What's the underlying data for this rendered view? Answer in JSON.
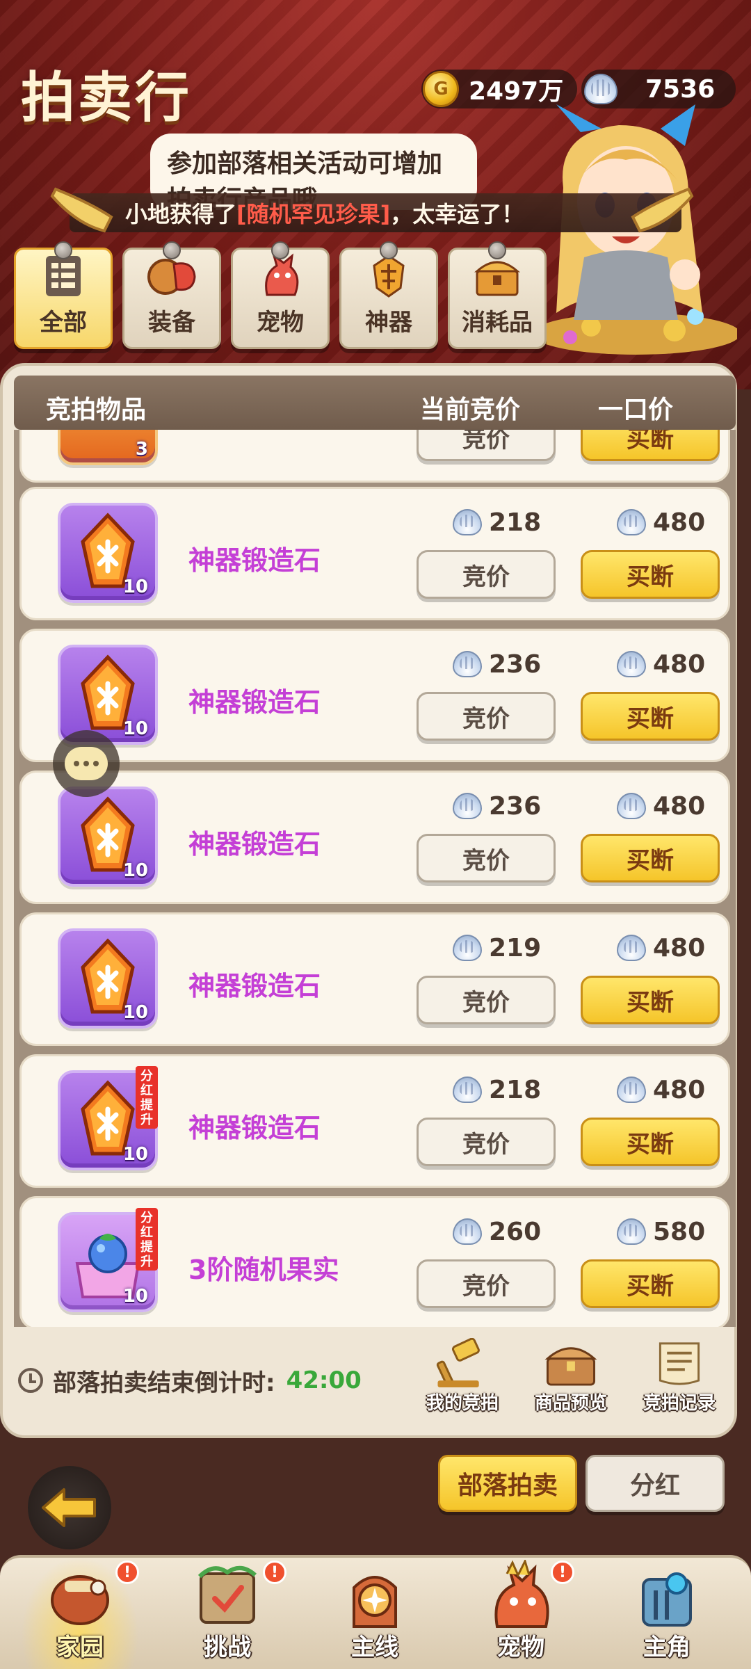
{
  "header": {
    "title": "拍卖行",
    "gold_amount": "2497万",
    "gem_amount": "7536",
    "tip_text": "参加部落相关活动可增加拍卖行产品哦",
    "announcement_prefix": "小地获得了",
    "announcement_item": "[随机罕见珍果]",
    "announcement_suffix": "，太幸运了！"
  },
  "categories": [
    {
      "label": "全部",
      "icon": "list-icon",
      "active": true
    },
    {
      "label": "装备",
      "icon": "equipment-icon",
      "active": false
    },
    {
      "label": "宠物",
      "icon": "pet-icon",
      "active": false
    },
    {
      "label": "神器",
      "icon": "artifact-icon",
      "active": false
    },
    {
      "label": "消耗品",
      "icon": "consumable-chest-icon",
      "active": false
    }
  ],
  "list_header": {
    "col_item": "竞拍物品",
    "col_current_bid": "当前竞价",
    "col_buyout": "一口价"
  },
  "partial_row": {
    "qty": "3",
    "bid_label": "竞价",
    "buy_label": "买断"
  },
  "rows": [
    {
      "name": "神器锻造石",
      "qty": "10",
      "bid": "218",
      "buyout": "480",
      "tag": "",
      "bid_label": "竞价",
      "buy_label": "买断"
    },
    {
      "name": "神器锻造石",
      "qty": "10",
      "bid": "236",
      "buyout": "480",
      "tag": "",
      "bid_label": "竞价",
      "buy_label": "买断"
    },
    {
      "name": "神器锻造石",
      "qty": "10",
      "bid": "236",
      "buyout": "480",
      "tag": "",
      "bid_label": "竞价",
      "buy_label": "买断"
    },
    {
      "name": "神器锻造石",
      "qty": "10",
      "bid": "219",
      "buyout": "480",
      "tag": "",
      "bid_label": "竞价",
      "buy_label": "买断"
    },
    {
      "name": "神器锻造石",
      "qty": "10",
      "bid": "218",
      "buyout": "480",
      "tag": "分红提升",
      "bid_label": "竞价",
      "buy_label": "买断"
    },
    {
      "name": "3阶随机果实",
      "qty": "10",
      "bid": "260",
      "buyout": "580",
      "tag": "分红提升",
      "bid_label": "竞价",
      "buy_label": "买断"
    }
  ],
  "footer": {
    "countdown_label": "部落拍卖结束倒计时:",
    "countdown_time": "42:00",
    "my_bids": "我的竞拍",
    "preview": "商品预览",
    "records": "竞拍记录"
  },
  "modes": {
    "auction": "部落拍卖",
    "dividend": "分红"
  },
  "nav": [
    {
      "label": "家园",
      "icon": "home-icon",
      "badge": "!",
      "active": true
    },
    {
      "label": "挑战",
      "icon": "challenge-icon",
      "badge": "!",
      "active": false
    },
    {
      "label": "主线",
      "icon": "main-quest-icon",
      "badge": "",
      "active": false
    },
    {
      "label": "宠物",
      "icon": "pet-dragon-icon",
      "badge": "!",
      "active": false
    },
    {
      "label": "主角",
      "icon": "hero-icon",
      "badge": "",
      "active": false
    }
  ],
  "colors": {
    "header_red": "#7a1c18",
    "item_name": "#c43fd6",
    "buy_yellow": "#f5c52a",
    "countdown_green": "#39a83a",
    "panel_bg": "#efe6d6"
  }
}
